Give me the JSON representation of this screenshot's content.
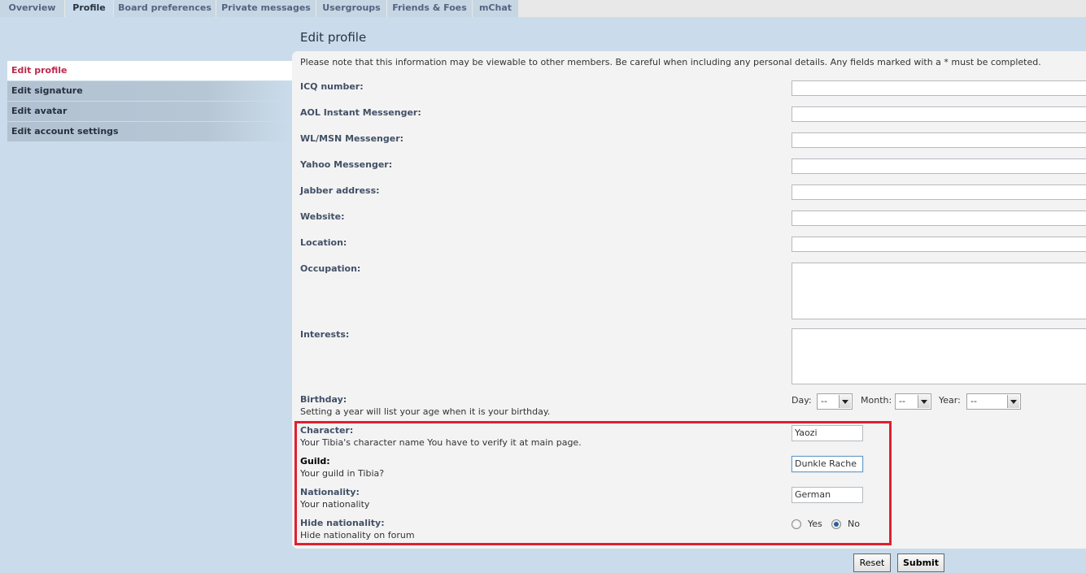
{
  "tabs": [
    {
      "label": "Overview",
      "active": false
    },
    {
      "label": "Profile",
      "active": true
    },
    {
      "label": "Board preferences",
      "active": false
    },
    {
      "label": "Private messages",
      "active": false
    },
    {
      "label": "Usergroups",
      "active": false
    },
    {
      "label": "Friends & Foes",
      "active": false
    },
    {
      "label": "mChat",
      "active": false
    }
  ],
  "sidebar": {
    "items": [
      {
        "label": "Edit profile",
        "active": true
      },
      {
        "label": "Edit signature",
        "active": false
      },
      {
        "label": "Edit avatar",
        "active": false
      },
      {
        "label": "Edit account settings",
        "active": false
      }
    ]
  },
  "main": {
    "title": "Edit profile",
    "note": "Please note that this information may be viewable to other members. Be careful when including any personal details. Any fields marked with a * must be completed.",
    "fields": {
      "icq": {
        "label": "ICQ number:",
        "value": ""
      },
      "aol": {
        "label": "AOL Instant Messenger:",
        "value": ""
      },
      "msn": {
        "label": "WL/MSN Messenger:",
        "value": ""
      },
      "yahoo": {
        "label": "Yahoo Messenger:",
        "value": ""
      },
      "jabber": {
        "label": "Jabber address:",
        "value": ""
      },
      "website": {
        "label": "Website:",
        "value": ""
      },
      "location": {
        "label": "Location:",
        "value": ""
      },
      "occupation": {
        "label": "Occupation:",
        "value": ""
      },
      "interests": {
        "label": "Interests:",
        "value": ""
      }
    },
    "birthday": {
      "label": "Birthday:",
      "explain": "Setting a year will list your age when it is your birthday.",
      "day_label": "Day:",
      "day_value": "--",
      "month_label": "Month:",
      "month_value": "--",
      "year_label": "Year:",
      "year_value": "--"
    },
    "custom": {
      "character": {
        "label": "Character:",
        "explain": "Your Tibia's character name You have to verify it at main page.",
        "value": "Yaozi"
      },
      "guild": {
        "label": "Guild:",
        "explain": "Your guild in Tibia?",
        "value": "Dunkle Rache"
      },
      "nationality": {
        "label": "Nationality:",
        "explain": "Your nationality",
        "value": "German"
      },
      "hide_nationality": {
        "label": "Hide nationality:",
        "explain": "Hide nationality on forum",
        "yes_label": "Yes",
        "no_label": "No",
        "selected": "No"
      }
    }
  },
  "buttons": {
    "reset": "Reset",
    "submit": "Submit"
  },
  "colors": {
    "background": "#cadceb",
    "panel": "#f3f3f3",
    "active_nav_text": "#bc2a4d",
    "highlight_border": "#e0202e"
  }
}
